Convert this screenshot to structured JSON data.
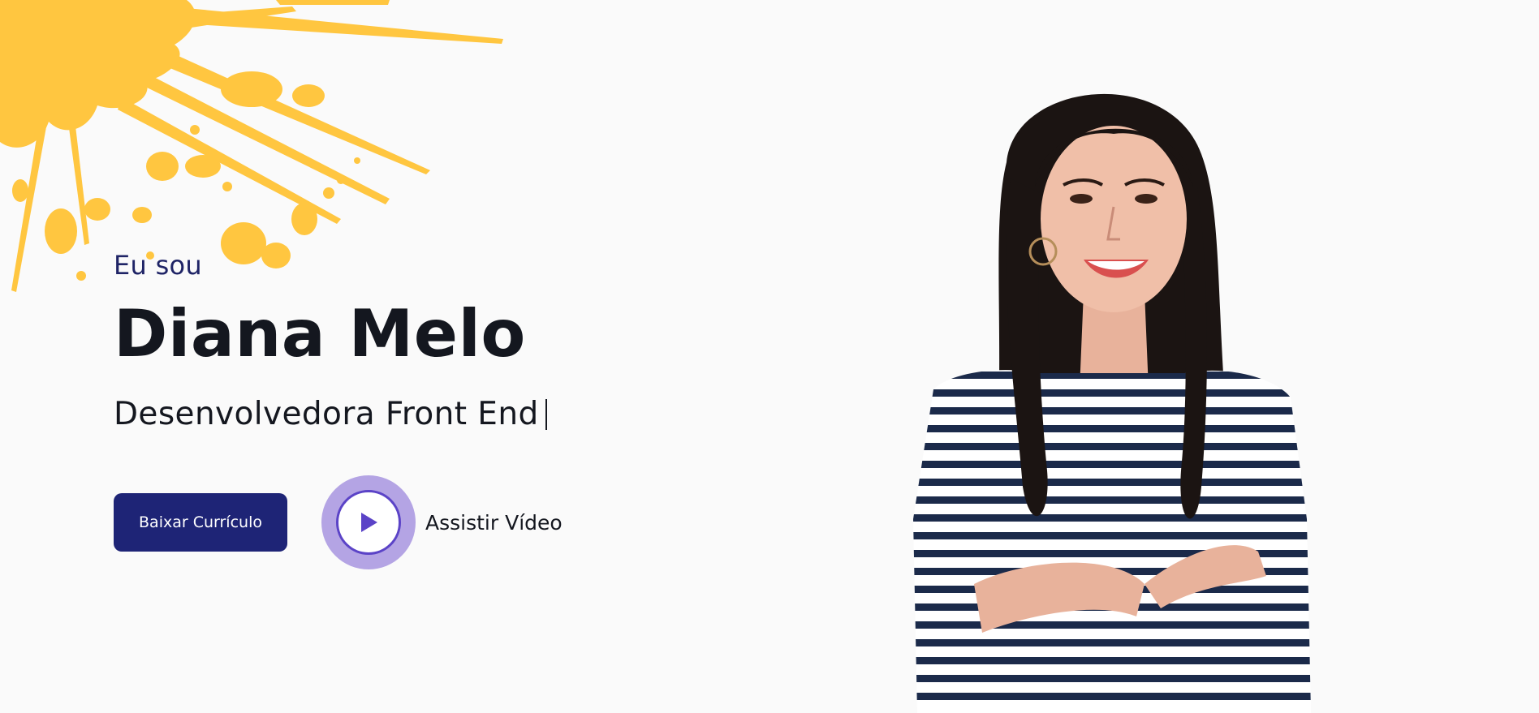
{
  "hero": {
    "eyebrow": "Eu sou",
    "name": "Diana Melo",
    "role": "Desenvolvedora Front End"
  },
  "actions": {
    "download_label": "Baixar Currículo",
    "video_label": "Assistir Vídeo"
  },
  "colors": {
    "accent_navy": "#1e2476",
    "splash_yellow": "#ffc640",
    "play_ring": "#b4a4e4",
    "play_purple": "#5b43c7",
    "background": "#fafafa"
  },
  "icons": {
    "play": "play-icon"
  }
}
